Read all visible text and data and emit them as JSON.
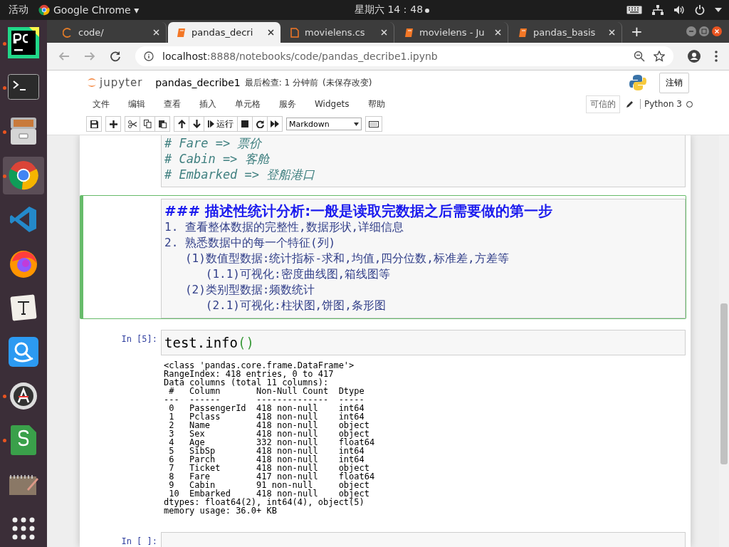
{
  "top_bar": {
    "activities": "活动",
    "app_name": "Google Chrome",
    "app_caret": "▾",
    "clock": "星期六 14：48",
    "clock_dot": true
  },
  "dock": [
    {
      "kind": "pycharm",
      "running": true,
      "selected": false
    },
    {
      "kind": "terminal",
      "running": true,
      "selected": false
    },
    {
      "kind": "files",
      "running": true,
      "selected": false
    },
    {
      "kind": "chrome",
      "running": true,
      "selected": true
    },
    {
      "kind": "vscode",
      "running": false,
      "selected": false
    },
    {
      "kind": "firefox",
      "running": false,
      "selected": false
    },
    {
      "kind": "typora",
      "running": false,
      "selected": false
    },
    {
      "kind": "finder",
      "running": false,
      "selected": false
    },
    {
      "kind": "appimage",
      "running": true,
      "selected": false
    },
    {
      "kind": "sheets",
      "running": true,
      "selected": false
    },
    {
      "kind": "notes",
      "running": false,
      "selected": false
    },
    {
      "kind": "apps",
      "running": false,
      "selected": false
    }
  ],
  "browser": {
    "tabs": [
      {
        "title": "code/",
        "kind": "loading",
        "selected": false
      },
      {
        "title": "pandas_decri",
        "kind": "notebook",
        "selected": true
      },
      {
        "title": "movielens.cs",
        "kind": "file",
        "selected": false
      },
      {
        "title": "movielens - Ju",
        "kind": "notebook",
        "selected": false
      },
      {
        "title": "pandas_basis",
        "kind": "notebook",
        "selected": false
      }
    ],
    "new_tab": "+",
    "url_host": "localhost",
    "url_rest": ":8888/notebooks/code/pandas_decribe1.ipynb"
  },
  "jupyter": {
    "logo_text": "jupyter",
    "notebook_name": "pandas_decribe1",
    "checkpoint": "最后检查: 1 分钟前",
    "unsaved": "(未保存改变)",
    "logout": "注销",
    "menu": [
      "文件",
      "编辑",
      "查看",
      "插入",
      "单元格",
      "服务",
      "Widgets",
      "帮助"
    ],
    "trusted": "可信的",
    "kernel": "Python 3",
    "kernel_busy": false,
    "toolbar": [
      {
        "kind": "save"
      },
      {
        "kind": "plus"
      },
      {
        "kind": "cut"
      },
      {
        "kind": "copy"
      },
      {
        "kind": "paste"
      },
      {
        "kind": "up"
      },
      {
        "kind": "down"
      },
      {
        "kind": "run",
        "label": "运行"
      },
      {
        "kind": "stop"
      },
      {
        "kind": "restart"
      },
      {
        "kind": "fastforward"
      },
      {
        "kind": "select",
        "label": "Markdown"
      },
      {
        "kind": "keyboard"
      }
    ]
  },
  "cells": [
    {
      "kind": "markdown",
      "selected": false,
      "lines": [
        "# Fare => 票价",
        "# Cabin => 客舱",
        "# Embarked => 登船港口"
      ]
    },
    {
      "kind": "markdown",
      "selected": true,
      "heading": "### 描述性统计分析:一般是读取完数据之后需要做的第一步",
      "lines": [
        "1. 查看整体数据的完整性,数据形状,详细信息",
        "2. 熟悉数据中的每一个特征(列)",
        "   (1)数值型数据:统计指标-求和,均值,四分位数,标准差,方差等",
        "      (1.1)可视化:密度曲线图,箱线图等",
        "   (2)类别型数据:频数统计",
        "      (2.1)可视化:柱状图,饼图,条形图"
      ]
    },
    {
      "kind": "code",
      "selected": false,
      "prompt": "In [5]:",
      "code": "test.info",
      "code_paren": "()",
      "output": [
        "<class 'pandas.core.frame.DataFrame'>",
        "RangeIndex: 418 entries, 0 to 417",
        "Data columns (total 11 columns):",
        " #   Column       Non-Null Count  Dtype  ",
        "---  ------       --------------  -----  ",
        " 0   PassengerId  418 non-null    int64  ",
        " 1   Pclass       418 non-null    int64  ",
        " 2   Name         418 non-null    object ",
        " 3   Sex          418 non-null    object ",
        " 4   Age          332 non-null    float64",
        " 5   SibSp        418 non-null    int64  ",
        " 6   Parch        418 non-null    int64  ",
        " 7   Ticket       418 non-null    object ",
        " 8   Fare         417 non-null    float64",
        " 9   Cabin        91 non-null     object ",
        " 10  Embarked     418 non-null    object ",
        "dtypes: float64(2), int64(4), object(5)",
        "memory usage: 36.0+ KB"
      ]
    },
    {
      "kind": "code",
      "selected": false,
      "prompt": "In [ ]:"
    }
  ]
}
